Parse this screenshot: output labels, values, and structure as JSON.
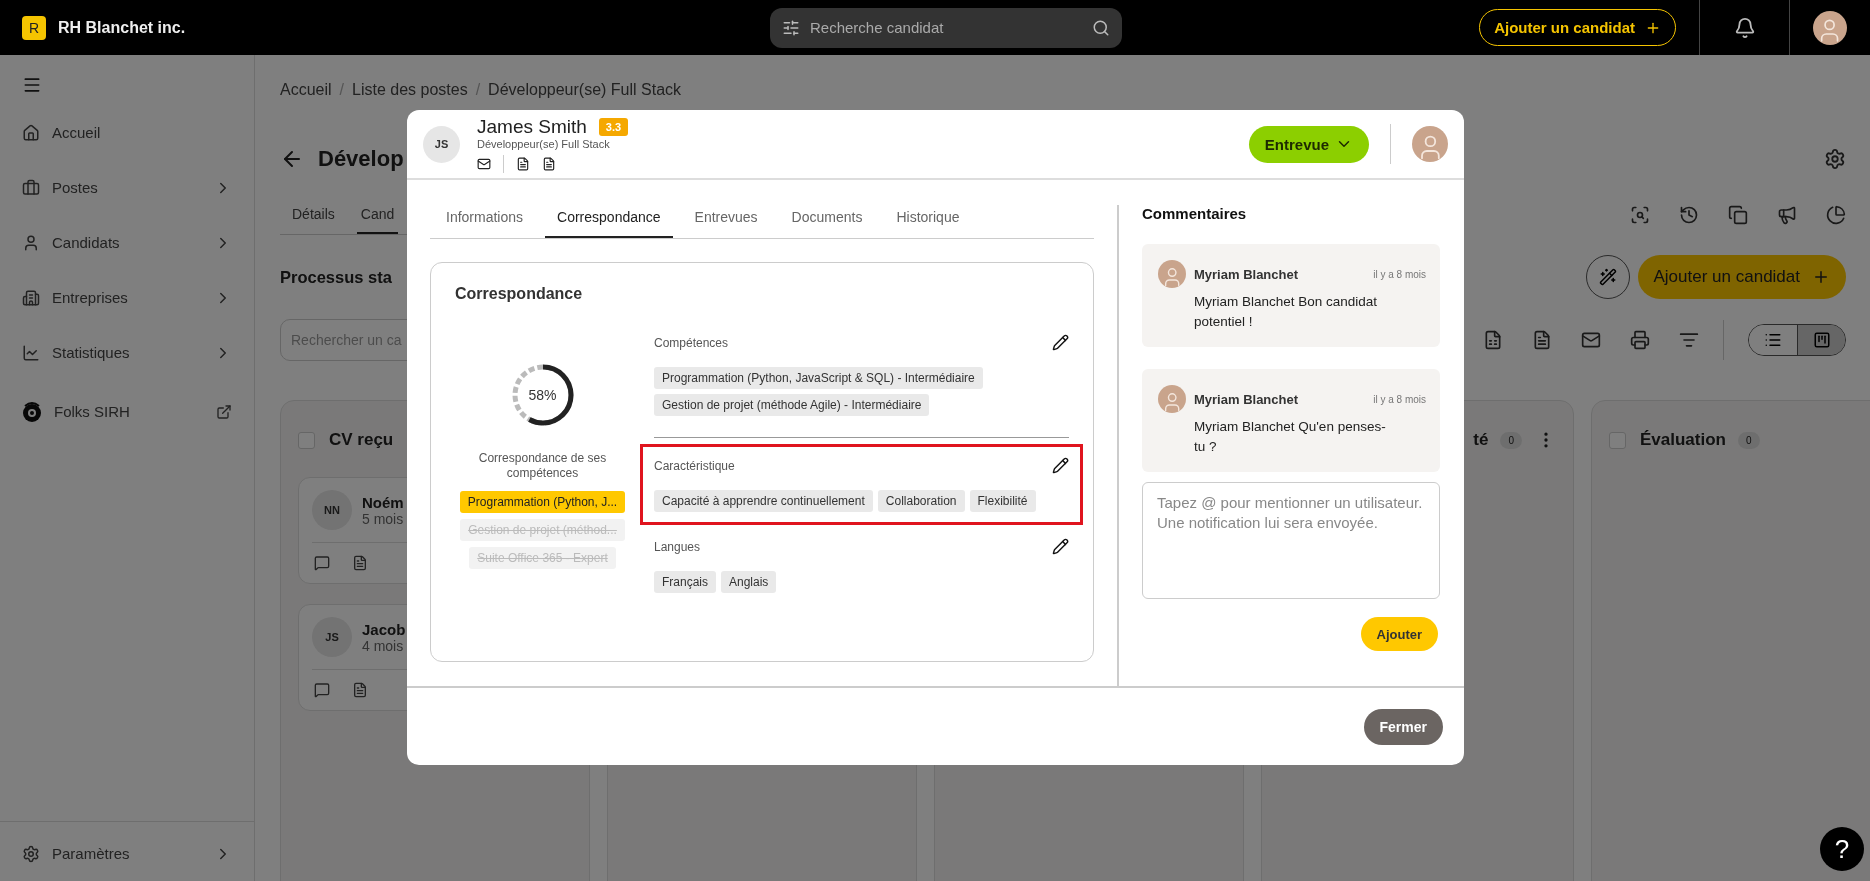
{
  "topbar": {
    "logo_letter": "R",
    "company": "RH Blanchet inc.",
    "search": {
      "placeholder": "Recherche candidat"
    },
    "add_button": "Ajouter un candidat"
  },
  "sidebar": {
    "items": [
      {
        "label": "Accueil",
        "expandable": false
      },
      {
        "label": "Postes",
        "expandable": true
      },
      {
        "label": "Candidats",
        "expandable": true
      },
      {
        "label": "Entreprises",
        "expandable": true
      },
      {
        "label": "Statistiques",
        "expandable": true
      },
      {
        "label": "Folks SIRH",
        "external": true
      }
    ],
    "footer_item": {
      "label": "Paramètres",
      "expandable": true
    }
  },
  "page": {
    "breadcrumb": [
      "Accueil",
      "Liste des postes",
      "Développeur(se) Full Stack"
    ],
    "breadcrumb_separator": "/",
    "title": "Dévelop",
    "tabs": [
      {
        "label": "Détails",
        "selected": false
      },
      {
        "label": "Cand",
        "selected": true
      }
    ],
    "section_title": "Processus sta",
    "add_button": "Ajouter un candidat",
    "search": {
      "placeholder": "Rechercher un ca"
    },
    "view_toggle": [
      {
        "selected": false
      },
      {
        "selected": true
      }
    ]
  },
  "columns": [
    {
      "title": "CV reçu",
      "checked": false,
      "cards": [
        {
          "initials": "NN",
          "name": "Noém",
          "time": "5 mois"
        },
        {
          "initials": "JS",
          "name": "Jacob",
          "time": "4 mois"
        }
      ]
    },
    {},
    {},
    {
      "title": "té",
      "count": "0",
      "menu": true
    },
    {
      "title": "Évaluation",
      "checked": false,
      "count": "0"
    }
  ],
  "modal": {
    "candidate": {
      "initials": "JS",
      "name": "James Smith",
      "score": "3.3",
      "position": "Développeur(se) Full Stack"
    },
    "status_button": "Entrevue",
    "tabs": [
      {
        "label": "Informations",
        "selected": false
      },
      {
        "label": "Correspondance",
        "selected": true
      },
      {
        "label": "Entrevues",
        "selected": false
      },
      {
        "label": "Documents",
        "selected": false
      },
      {
        "label": "Historique",
        "selected": false
      }
    ],
    "match": {
      "title": "Correspondance",
      "level": 0.58,
      "percent": "58%",
      "caption": "Correspondance de ses compétences",
      "skills": [
        {
          "label": "Programmation (Python, J...",
          "matched": true
        },
        {
          "label": "Gestion de projet (méthod...",
          "matched": false
        },
        {
          "label": "Suite Office 365 - Expert",
          "matched": false
        }
      ],
      "sections": [
        {
          "title": "Compétences",
          "highlighted": false,
          "tags": [
            "Programmation (Python, JavaScript & SQL) - Intermédiaire",
            "Gestion de projet (méthode Agile) - Intermédiaire"
          ]
        },
        {
          "title": "Caractéristique",
          "highlighted": true,
          "tags": [
            "Capacité à apprendre continuellement",
            "Collaboration",
            "Flexibilité"
          ]
        },
        {
          "title": "Langues",
          "highlighted": false,
          "tags": [
            "Français",
            "Anglais"
          ]
        }
      ]
    },
    "comments": {
      "title": "Commentaires",
      "items": [
        {
          "author": "Myriam Blanchet",
          "time": "il y a 8 mois",
          "text": "Myriam Blanchet Bon candidat potentiel !"
        },
        {
          "author": "Myriam Blanchet",
          "time": "il y a 8 mois",
          "text": "Myriam Blanchet Qu'en penses-tu ?"
        }
      ],
      "input": {
        "placeholder": "Tapez @ pour mentionner un utilisateur. Une notification lui sera envoyée."
      },
      "submit": "Ajouter"
    },
    "close_button": "Fermer"
  },
  "help_button": "?"
}
